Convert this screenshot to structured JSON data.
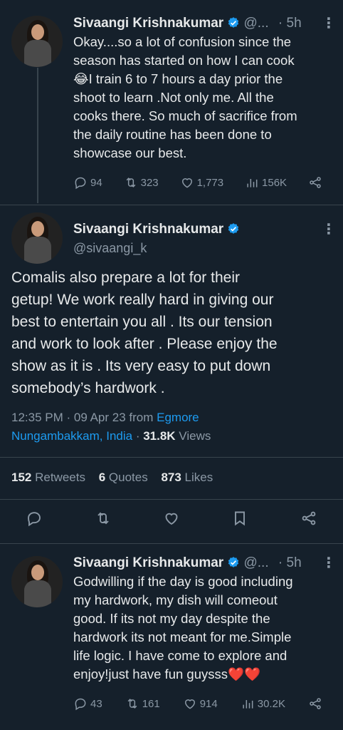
{
  "tweet1": {
    "name": "Sivaangi Krishnakumar",
    "handle": "@...",
    "time": "· 5h",
    "more": "⋮",
    "text": "Okay....so a lot of confusion since the\nseason has started on how I can cook\n😂I train 6 to 7 hours a day prior the\nshoot to learn .Not only me. All the\ncooks there. So much of sacrifice from\nthe daily routine has been done to\nshowcase our best.",
    "replies": "94",
    "retweets": "323",
    "likes": "1,773",
    "views": "156K"
  },
  "main_tweet": {
    "name": "Sivaangi Krishnakumar",
    "handle": "@sivaangi_k",
    "more": "⋮",
    "text": "Comalis also prepare a lot for their\ngetup! We work really hard in giving our\nbest to entertain you all . Its our tension\nand work to look after . Please enjoy the\nshow as it is . Its very easy to put down\nsomebody’s hardwork .",
    "timestamp": "12:35 PM · 09 Apr 23 from ",
    "location_part1": "Egmore",
    "location_part2": "Nungambakkam, India",
    "views_sep": " · ",
    "views_count": "31.8K",
    "views_label": " Views",
    "retweets_count": "152",
    "retweets_label": " Retweets",
    "quotes_count": "6",
    "quotes_label": " Quotes",
    "likes_count": "873",
    "likes_label": " Likes"
  },
  "tweet3": {
    "name": "Sivaangi Krishnakumar",
    "handle": "@...",
    "time": "· 5h",
    "more": "⋮",
    "text": "Godwilling if the day is good including\nmy hardwork, my dish will comeout\ngood. If its not my day despite the\nhardwork its not meant for me.Simple\nlife logic. I have come to explore and\nenjoy!just have fun guysss❤️❤️",
    "replies": "43",
    "retweets": "161",
    "likes": "914",
    "views": "30.2K"
  },
  "colors": {
    "background": "#15202b",
    "text": "#e7e9ea",
    "secondary": "#8b98a5",
    "link": "#1d9bf0",
    "verified": "#1d9bf0",
    "divider": "#38444d"
  },
  "icons": [
    "verified-badge-icon",
    "reply-icon",
    "retweet-icon",
    "like-icon",
    "views-icon",
    "share-icon",
    "bookmark-icon",
    "more-icon"
  ]
}
